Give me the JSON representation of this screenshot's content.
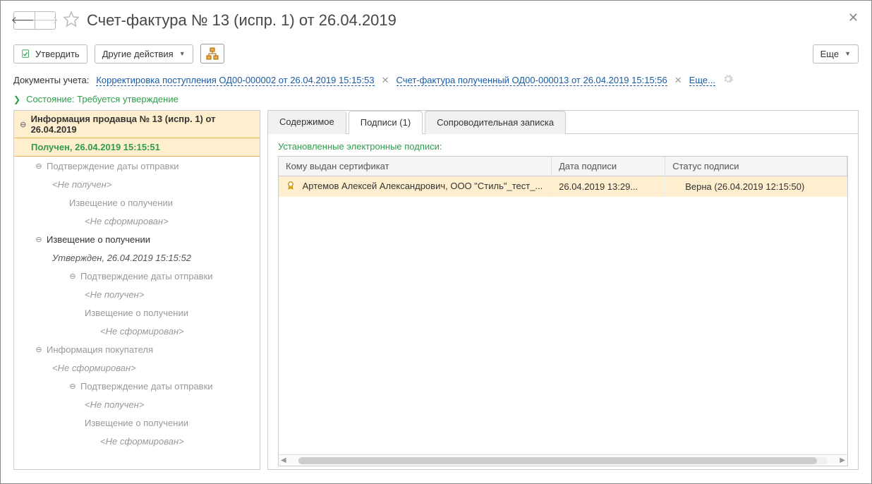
{
  "title": "Счет-фактура № 13 (испр. 1) от 26.04.2019",
  "toolbar": {
    "approve": "Утвердить",
    "other_actions": "Другие действия",
    "more": "Еще"
  },
  "docs": {
    "label": "Документы учета:",
    "link1": "Корректировка поступления ОД00-000002 от 26.04.2019 15:15:53",
    "link2": "Счет-фактура полученный ОД00-000013 от 26.04.2019 15:15:56",
    "more_link": "Еще..."
  },
  "state": {
    "text": "Состояние: Требуется утверждение"
  },
  "tree": {
    "header": "Информация продавца № 13 (испр. 1) от 26.04.2019",
    "status": "Получен, 26.04.2019 15:15:51",
    "n1": "Подтверждение даты отправки",
    "n1s": "<Не получен>",
    "n1a": "Извещение о получении",
    "n1as": "<Не сформирован>",
    "n2": "Извещение о получении",
    "n2s": "Утвержден, 26.04.2019 15:15:52",
    "n2a": "Подтверждение даты отправки",
    "n2as": "<Не получен>",
    "n2b": "Извещение о получении",
    "n2bs": "<Не сформирован>",
    "n3": "Информация покупателя",
    "n3s": "<Не сформирован>",
    "n3a": "Подтверждение даты отправки",
    "n3as": "<Не получен>",
    "n3b": "Извещение о получении",
    "n3bs": "<Не сформирован>"
  },
  "tabs": {
    "content": "Содержимое",
    "signatures": "Подписи (1)",
    "note": "Сопроводительная записка"
  },
  "signatures": {
    "caption": "Установленные электронные подписи:",
    "headers": {
      "cert": "Кому выдан сертификат",
      "date": "Дата подписи",
      "status": "Статус подписи"
    },
    "rows": [
      {
        "cert": "Артемов Алексей Александрович, ООО \"Стиль\"_тест_...",
        "date": "26.04.2019 13:29...",
        "status": "Верна (26.04.2019 12:15:50)"
      }
    ]
  }
}
